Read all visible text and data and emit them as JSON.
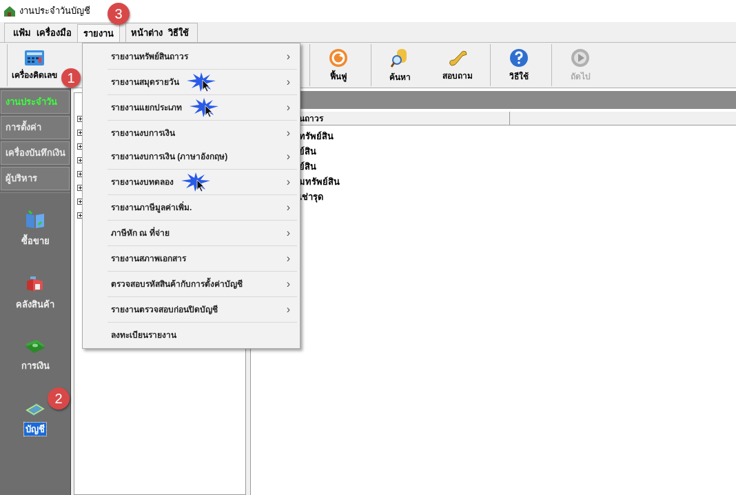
{
  "window": {
    "title": "งานประจำวันบัญชี"
  },
  "menubar": [
    {
      "label": "แฟ้ม",
      "selected": false
    },
    {
      "label": "เครื่องมือ",
      "selected": false
    },
    {
      "label": "รายงาน",
      "selected": true
    },
    {
      "label": "หน้าต่าง",
      "selected": false
    },
    {
      "label": "วิธีใช้",
      "selected": false
    }
  ],
  "toolbar": [
    {
      "buttons": [
        {
          "label": "เครื่องคิดเลข",
          "kind": "calculator",
          "disabled": false
        }
      ]
    },
    {
      "buttons": [
        {
          "label": "ฟื้นฟู",
          "kind": "refresh",
          "disabled": false
        }
      ]
    },
    {
      "buttons": [
        {
          "label": "ค้นหา",
          "kind": "search",
          "disabled": false
        },
        {
          "label": "สอบถาม",
          "kind": "phone",
          "disabled": false
        }
      ]
    },
    {
      "buttons": [
        {
          "label": "วิธีใช้",
          "kind": "help",
          "disabled": false
        }
      ]
    },
    {
      "buttons": [
        {
          "label": "ถัดไป",
          "kind": "next",
          "disabled": true
        }
      ]
    }
  ],
  "nav_tabs": [
    {
      "label": "งานประจำวัน",
      "selected": true
    },
    {
      "label": "การตั้งค่า",
      "selected": false
    },
    {
      "label": "เครื่องบันทึกเงิน",
      "selected": false
    },
    {
      "label": "ผู้บริหาร",
      "selected": false
    }
  ],
  "modules": [
    {
      "label": "ซื้อขาย",
      "kind": "book",
      "selected": false
    },
    {
      "label": "คลังสินค้า",
      "kind": "warehouse",
      "selected": false
    },
    {
      "label": "การเงิน",
      "kind": "money",
      "selected": false
    },
    {
      "label": "บัญชี",
      "kind": "ledger",
      "selected": true
    }
  ],
  "tree": {
    "nodes": [
      {
        "expanded": false
      },
      {
        "expanded": false
      },
      {
        "expanded": false
      },
      {
        "expanded": false
      },
      {
        "expanded": false
      },
      {
        "expanded": false
      },
      {
        "expanded": false
      },
      {
        "expanded": false
      }
    ]
  },
  "table": {
    "columns": [
      "นถาวร"
    ],
    "rows": [
      "ทรัพย์สิน",
      "ย์สิน",
      "ย์สิน",
      "มทรัพย์สิน",
      "เช่ารุด"
    ]
  },
  "report_menu": [
    [
      {
        "label": "รายงานทรัพย์สินถาวร",
        "submenu": true,
        "cursor": false
      }
    ],
    [
      {
        "label": "รายงานสมุดรายวัน",
        "submenu": true,
        "cursor": true
      }
    ],
    [
      {
        "label": "รายงานแยกประเภท",
        "submenu": true,
        "cursor": true
      }
    ],
    [
      {
        "label": "รายงานงบการเงิน",
        "submenu": true,
        "cursor": false
      },
      {
        "label": "รายงานงบการเงิน (ภาษาอังกฤษ)",
        "submenu": true,
        "cursor": false
      }
    ],
    [
      {
        "label": "รายงานงบทดลอง",
        "submenu": true,
        "cursor": true
      }
    ],
    [
      {
        "label": "รายงานภาษีมูลค่าเพิ่ม.",
        "submenu": true,
        "cursor": false
      }
    ],
    [
      {
        "label": "ภาษีหัก ณ ที่จ่าย",
        "submenu": true,
        "cursor": false
      }
    ],
    [
      {
        "label": "รายงานสภาพเอกสาร",
        "submenu": true,
        "cursor": false
      }
    ],
    [
      {
        "label": "ตรวจสอบรหัสสินค้ากับการตั้งค่าบัญชี",
        "submenu": true,
        "cursor": false
      }
    ],
    [
      {
        "label": "รายงานตรวจสอบก่อนปิดบัญชี",
        "submenu": true,
        "cursor": false
      }
    ],
    [
      {
        "label": "ลงทะเบียนรายงาน",
        "submenu": false,
        "cursor": false
      }
    ]
  ],
  "submenu_arrow": "›",
  "annotations": [
    {
      "label": "1"
    },
    {
      "label": "2"
    },
    {
      "label": "3"
    }
  ]
}
